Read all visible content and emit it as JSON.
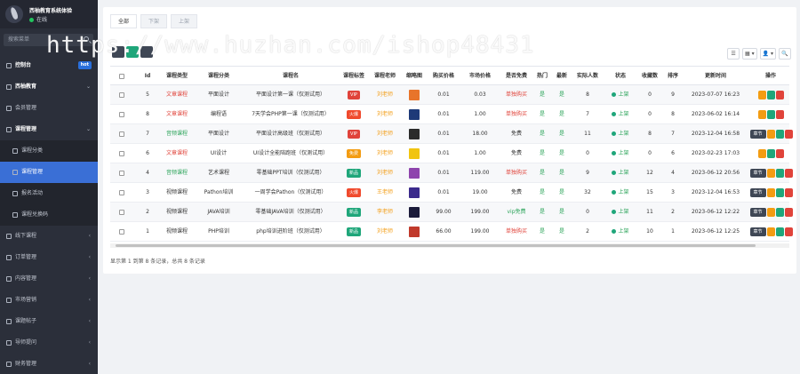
{
  "sidebar": {
    "site_name": "西柚教育系统体验",
    "status": "在线",
    "search_placeholder": "搜索菜单",
    "items": [
      {
        "label": "控制台",
        "badge": "hot"
      },
      {
        "label": "西柚教育",
        "arrow": "⌄"
      },
      {
        "label": "会员管理"
      },
      {
        "label": "课程管理",
        "arrow": "⌄"
      },
      {
        "label": "课程分类"
      },
      {
        "label": "课程管理"
      },
      {
        "label": "报名活动"
      },
      {
        "label": "课程兑换码"
      },
      {
        "label": "线下课程",
        "arrow": "‹"
      },
      {
        "label": "订单管理",
        "arrow": "‹"
      },
      {
        "label": "内容管理",
        "arrow": "‹"
      },
      {
        "label": "市场营销",
        "arrow": "‹"
      },
      {
        "label": "课题帖子",
        "arrow": "‹"
      },
      {
        "label": "导师提问",
        "arrow": "‹"
      },
      {
        "label": "财务管理",
        "arrow": "‹"
      }
    ]
  },
  "tabs": [
    "全部",
    "下架",
    "上架"
  ],
  "toolbar_right": [
    "☰",
    "▦ ▾",
    "👤 ▾",
    "🔍"
  ],
  "columns": [
    "",
    "Id",
    "课程类型",
    "课程分类",
    "课程名",
    "课程标签",
    "课程老师",
    "缩略图",
    "购买价格",
    "市场价格",
    "是否免费",
    "热门",
    "最新",
    "实际人数",
    "状态",
    "收藏数",
    "排序",
    "更新时间",
    "操作"
  ],
  "rows": [
    {
      "id": "5",
      "type": "文章课程",
      "category": "平面设计",
      "name": "平面设计第一课（仅测试用）",
      "tag": "VIP",
      "teacher": "刘老师",
      "price": "0.01",
      "market": "0.03",
      "free": "单独购买",
      "hot": "是",
      "new": "是",
      "people": "8",
      "status": "上架",
      "fav": "0",
      "sort": "9",
      "time": "2023-07-07 16:23"
    },
    {
      "id": "8",
      "type": "文章课程",
      "category": "编程语",
      "name": "7天学会PHP第一课（仅测试用）",
      "tag": "火爆",
      "teacher": "刘老师",
      "price": "0.01",
      "market": "1.00",
      "free": "单独购买",
      "hot": "是",
      "new": "是",
      "people": "7",
      "status": "上架",
      "fav": "0",
      "sort": "8",
      "time": "2023-06-02 16:14"
    },
    {
      "id": "7",
      "type": "音频课程",
      "category": "平面设计",
      "name": "平面设计高级班（仅测试用）",
      "tag": "VIP",
      "teacher": "刘老师",
      "price": "0.01",
      "market": "18.00",
      "free": "免费",
      "hot": "是",
      "new": "是",
      "people": "11",
      "status": "上架",
      "fav": "8",
      "sort": "7",
      "time": "2023-12-04 16:58"
    },
    {
      "id": "6",
      "type": "文章课程",
      "category": "UI设计",
      "name": "UI设计全能陪跑班（仅测试用）",
      "tag": "免费",
      "teacher": "刘老师",
      "price": "0.01",
      "market": "1.00",
      "free": "免费",
      "hot": "是",
      "new": "是",
      "people": "0",
      "status": "上架",
      "fav": "0",
      "sort": "6",
      "time": "2023-02-23 17:03"
    },
    {
      "id": "4",
      "type": "音频课程",
      "category": "艺术课程",
      "name": "零基础PPT培训（仅测试用）",
      "tag": "新品",
      "teacher": "刘老师",
      "price": "0.01",
      "market": "119.00",
      "free": "单独购买",
      "hot": "是",
      "new": "是",
      "people": "9",
      "status": "上架",
      "fav": "12",
      "sort": "4",
      "time": "2023-06-12 20:56"
    },
    {
      "id": "3",
      "type": "视频课程",
      "category": "Pathon培训",
      "name": "一周学会Pathon（仅测试用）",
      "tag": "火爆",
      "teacher": "王老师",
      "price": "0.01",
      "market": "19.00",
      "free": "免费",
      "hot": "是",
      "new": "是",
      "people": "32",
      "status": "上架",
      "fav": "15",
      "sort": "3",
      "time": "2023-12-04 16:53"
    },
    {
      "id": "2",
      "type": "视频课程",
      "category": "JAVA培训",
      "name": "零基础JAVA培训（仅测试用）",
      "tag": "新品",
      "teacher": "李老师",
      "price": "99.00",
      "market": "199.00",
      "free": "vip免费",
      "hot": "是",
      "new": "是",
      "people": "0",
      "status": "上架",
      "fav": "11",
      "sort": "2",
      "time": "2023-06-12 12:22"
    },
    {
      "id": "1",
      "type": "视频课程",
      "category": "PHP培训",
      "name": "php培训进阶班（仅测试用）",
      "tag": "新品",
      "teacher": "刘老师",
      "price": "66.00",
      "market": "199.00",
      "free": "单独购买",
      "hot": "是",
      "new": "是",
      "people": "2",
      "status": "上架",
      "fav": "10",
      "sort": "1",
      "time": "2023-06-12 12:25"
    }
  ],
  "chapter_label": "章节",
  "footer": "显示第 1 到第 8 条记录，总共 8 条记录",
  "watermark": "https://www.huzhan.com/ishop48431",
  "colors": {
    "sidebar_bg": "#2b2f3a",
    "active_menu": "#3a6fd6",
    "tag_vip": "#e0433a",
    "tag_hot": "#f04a2d",
    "tag_free": "#f39c12",
    "tag_new": "#1fa67a",
    "online": "#1fa67a"
  }
}
